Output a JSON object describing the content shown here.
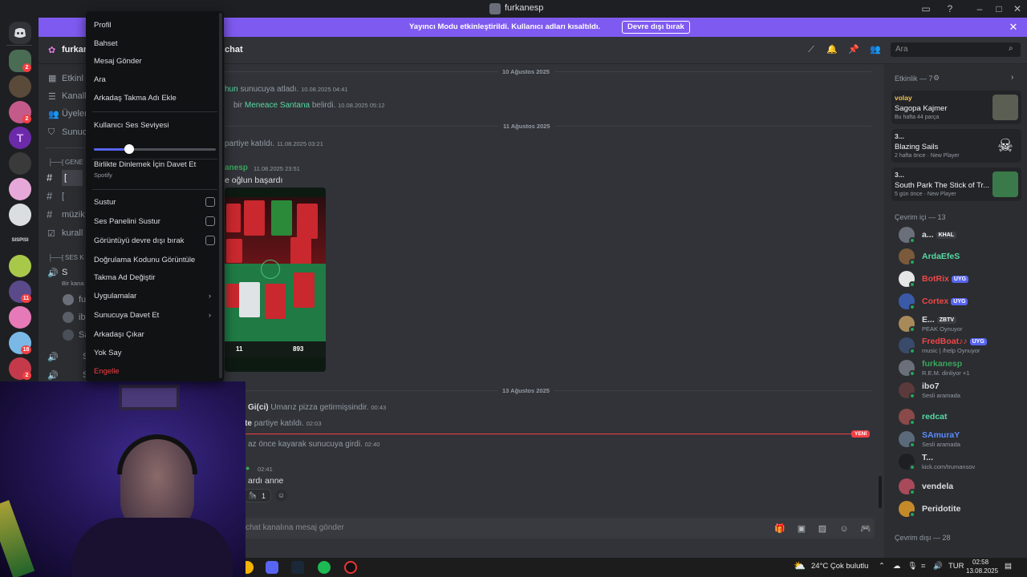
{
  "window": {
    "title": "furkanesp"
  },
  "banner": {
    "message": "Yayıncı Modu etkinleştirildi. Kullanıcı adları kısaltıldı.",
    "button": "Devre dışı bırak"
  },
  "rail_badges": [
    "2",
    "2",
    "11",
    "18",
    "2"
  ],
  "rail_server_text": "SISPISI",
  "sidebar": {
    "server_name": "furkan",
    "items": [
      "Etkinl",
      "Kanall",
      "Üyeler",
      "Sunucı"
    ],
    "category_gen": "GENE",
    "channels": [
      "[",
      "[",
      "müzik",
      "kurall"
    ],
    "category_ses": "SES K",
    "voice_channel": "S",
    "voice_sub": "Bir kana",
    "voice_users": [
      "fu",
      "ib",
      "Sa"
    ],
    "voice_channel2": "S",
    "voice_channel3": "S"
  },
  "header": {
    "channel": "chat",
    "search_placeholder": "Ara"
  },
  "messages": {
    "date1": "10 Ağustos 2025",
    "m1_name": "hun",
    "m1_text": "sunucuya atladı.",
    "m1_ts": "10.08.2025 04:41",
    "m2_pre": "bir",
    "m2_name": "Meneace Santana",
    "m2_text": "belirdi.",
    "m2_ts": "10.08.2025 05:12",
    "date2": "11 Ağustos 2025",
    "m3_text": "partiye katıldı.",
    "m3_ts": "11.08.2025 03:21",
    "m4_name": "anesp",
    "m4_ts": "11.08.2025 23:51",
    "m4_text": "e oğlun başardı",
    "card_bottom_left": "11",
    "card_bottom_right": "893",
    "date3": "13 Ağustos 2025",
    "m5_name": "Gi(ci)",
    "m5_text": "Umarız pizza getirmişsindir.",
    "m5_ts": "00:43",
    "m6_name": "te",
    "m6_text": "partiye katıldı.",
    "m6_ts": "02:03",
    "new_label": "YENİ",
    "m7_text": "az önce kayarak sunucuya girdi.",
    "m7_ts": "02:40",
    "m8_ts": "02:41",
    "m8_text": "ardı anne",
    "reaction_count": "1",
    "composer_placeholder": "chat kanalına mesaj gönder"
  },
  "context_menu": {
    "items_top": [
      "Profil",
      "Bahset",
      "Mesaj Gönder",
      "Ara",
      "Arkadaş Takma Adı Ekle"
    ],
    "volume_label": "Kullanıcı Ses Seviyesi",
    "volume_level": 0.29,
    "listen_label": "Birlikte Dinlemek İçin Davet Et",
    "listen_sub": "Spotify",
    "check_items": [
      "Sustur",
      "Ses Panelini Sustur",
      "Görüntüyü devre dışı bırak"
    ],
    "items_mid": [
      "Doğrulama Kodunu Görüntüle",
      "Takma Ad Değiştir"
    ],
    "submenu_items": [
      "Uygulamalar",
      "Sunucuya Davet Et"
    ],
    "items_bottom": [
      "Arkadaşı Çıkar",
      "Yok Say"
    ],
    "danger_item": "Engelle",
    "danger_color": "#f23f43"
  },
  "activity": {
    "header": "Etkinlik — 7",
    "cards": [
      {
        "top": "volay",
        "title": "Sagopa Kajmer",
        "sub": "Bu hafta 44 parça"
      },
      {
        "top": "3...",
        "title": "Blazing Sails",
        "sub": "2 hafta önce",
        "sub2": "New Player"
      },
      {
        "top": "3...",
        "title": "South Park The Stick of Tr...",
        "sub": "5 gün önce",
        "sub2": "New Player"
      }
    ]
  },
  "online": {
    "header": "Çevrim içi — 13",
    "members": [
      {
        "name": "a...",
        "tag": "KHAL",
        "color": "#dbdee1",
        "tag_color": "#3b3d44",
        "sub": ""
      },
      {
        "name": "ArdaEfeS",
        "color": "#57d9a3",
        "sub": ""
      },
      {
        "name": "BotRix",
        "tag": "UYG",
        "color": "#f04747",
        "tag_color": "#5865f2",
        "sub": ""
      },
      {
        "name": "Cortex",
        "tag": "UYG",
        "color": "#f04747",
        "tag_color": "#5865f2",
        "sub": ""
      },
      {
        "name": "E...",
        "tag": "ZBTV",
        "color": "#dbdee1",
        "tag_color": "#3b3d44",
        "sub": "PEAK Oynuyor"
      },
      {
        "name": "FredBoat♪♪",
        "tag": "UYG",
        "color": "#f04747",
        "tag_color": "#5865f2",
        "sub": "music | /help Oynuyor"
      },
      {
        "name": "furkanesp",
        "color": "#3ba55d",
        "sub": "R.E.M. dinliyor +1"
      },
      {
        "name": "ibo7",
        "color": "#dbdee1",
        "sub": "Sesli aramada"
      },
      {
        "name": "redcat",
        "color": "#57d9a3",
        "sub": ""
      },
      {
        "name": "SAmuraY",
        "color": "#5b8cff",
        "sub": "Sesli aramada"
      },
      {
        "name": "T...",
        "color": "#dbdee1",
        "sub": "kick.com/trumansov"
      },
      {
        "name": "vendela",
        "color": "#dbdee1",
        "sub": ""
      },
      {
        "name": "Peridotite",
        "color": "#dbdee1",
        "sub": ""
      }
    ],
    "offline_header": "Çevrim dışı — 28"
  },
  "taskbar": {
    "weather": "24°C  Çok bulutlu",
    "lang": "TUR",
    "time": "02:58",
    "date": "13.08.2025"
  }
}
